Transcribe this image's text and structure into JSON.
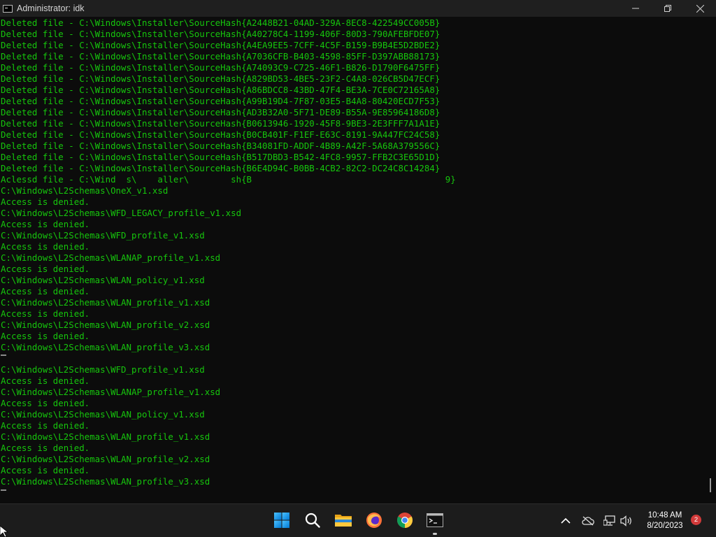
{
  "window": {
    "title": "Administrator: idk",
    "controls": {
      "minimize": "—",
      "maximize": "❐",
      "close": "✕"
    }
  },
  "console": {
    "lines": [
      "Deleted file - C:\\Windows\\Installer\\SourceHash{A2448B21-04AD-329A-8EC8-422549CC005B}",
      "Deleted file - C:\\Windows\\Installer\\SourceHash{A40278C4-1199-406F-80D3-790AFEBFDE07}",
      "Deleted file - C:\\Windows\\Installer\\SourceHash{A4EA9EE5-7CFF-4C5F-B159-B9B4E5D2BDE2}",
      "Deleted file - C:\\Windows\\Installer\\SourceHash{A7036CFB-B403-4598-85FF-D397ABB88173}",
      "Deleted file - C:\\Windows\\Installer\\SourceHash{A74093C9-C725-46F1-B826-D1790F6475FF}",
      "Deleted file - C:\\Windows\\Installer\\SourceHash{A829BD53-4BE5-23F2-C4A8-026CB5D47ECF}",
      "Deleted file - C:\\Windows\\Installer\\SourceHash{A86BDCC8-43BD-47F4-BE3A-7CE0C72165A8}",
      "Deleted file - C:\\Windows\\Installer\\SourceHash{A99B19D4-7F87-03E5-B4A8-80420ECD7F53}",
      "Deleted file - C:\\Windows\\Installer\\SourceHash{AD3B32A0-5F71-DE89-B55A-9E85964186D8}",
      "Deleted file - C:\\Windows\\Installer\\SourceHash{B0613946-1920-45F8-9BE3-2E3FFF7A1A1E}",
      "Deleted file - C:\\Windows\\Installer\\SourceHash{B0CB401F-F1EF-E63C-8191-9A447FC24C58}",
      "Deleted file - C:\\Windows\\Installer\\SourceHash{B34081FD-ADDF-4B89-A42F-5A68A379556C}",
      "Deleted file - C:\\Windows\\Installer\\SourceHash{B517DBD3-B542-4FC8-9957-FFB2C3E65D1D}",
      "Deleted file - C:\\Windows\\Installer\\SourceHash{B6E4D94C-B0BB-4CB2-82C2-DC24C8C14284}",
      "Aclessd file - C:\\Wind  s\\    aller\\        sh{B                                     9}",
      "C:\\Windows\\L2Schemas\\OneX_v1.xsd",
      "Access is denied.",
      "C:\\Windows\\L2Schemas\\WFD_LEGACY_profile_v1.xsd",
      "Access is denied.",
      "C:\\Windows\\L2Schemas\\WFD_profile_v1.xsd",
      "Access is denied.",
      "C:\\Windows\\L2Schemas\\WLANAP_profile_v1.xsd",
      "Access is denied.",
      "C:\\Windows\\L2Schemas\\WLAN_policy_v1.xsd",
      "Access is denied.",
      "C:\\Windows\\L2Schemas\\WLAN_profile_v1.xsd",
      "Access is denied.",
      "C:\\Windows\\L2Schemas\\WLAN_profile_v2.xsd",
      "Access is denied.",
      "C:\\Windows\\L2Schemas\\WLAN_profile_v3.xsd",
      "",
      "C:\\Windows\\L2Schemas\\WFD_profile_v1.xsd",
      "Access is denied.",
      "C:\\Windows\\L2Schemas\\WLANAP_profile_v1.xsd",
      "Access is denied.",
      "C:\\Windows\\L2Schemas\\WLAN_policy_v1.xsd",
      "Access is denied.",
      "C:\\Windows\\L2Schemas\\WLAN_profile_v1.xsd",
      "Access is denied.",
      "C:\\Windows\\L2Schemas\\WLAN_profile_v2.xsd",
      "Access is denied.",
      "C:\\Windows\\L2Schemas\\WLAN_profile_v3.xsd"
    ]
  },
  "taskbar": {
    "icons": [
      "start-icon",
      "search-icon",
      "file-explorer-icon",
      "firefox-icon",
      "chrome-icon",
      "terminal-icon"
    ],
    "tray_icons": [
      "chevron-up-icon",
      "cloud-offline-icon",
      "network-icon",
      "volume-icon"
    ],
    "clock": {
      "time": "10:48 AM",
      "date": "8/20/2023"
    },
    "notification_count": "2",
    "accent": "#0078d4"
  }
}
